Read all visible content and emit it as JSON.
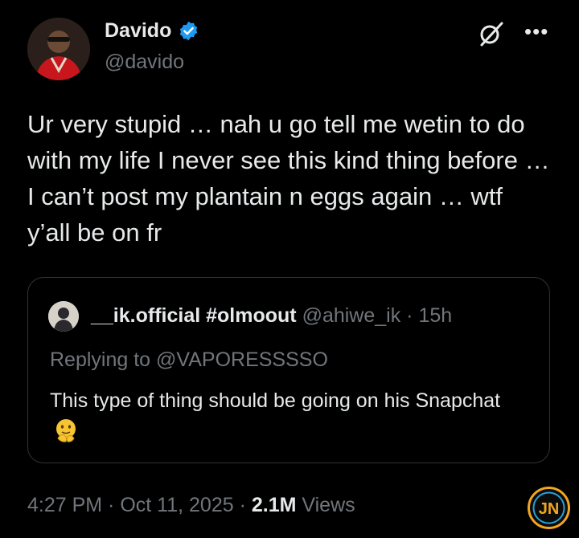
{
  "author": {
    "name": "Davido",
    "handle": "@davido",
    "verified": true
  },
  "tweet": {
    "text": "Ur very stupid … nah u go tell me wetin to do with my life I never see this kind thing before … I can’t post my plantain n eggs again … wtf y’all be on fr"
  },
  "quote": {
    "name": "__ik.official #olmoout",
    "handle": "@ahiwe_ik",
    "separator": " · ",
    "time": "15h",
    "replying_to": "Replying to @VAPORESSSSO",
    "text": "This type of thing should be going on his Snapchat"
  },
  "footer": {
    "time": "4:27 PM",
    "dot1": " · ",
    "date": "Oct 11, 2025",
    "dot2": " · ",
    "views_count": "2.1M",
    "views_label": " Views"
  },
  "more_label": "•••",
  "icons": {
    "verified": "verified-badge-icon",
    "grok": "grok-icon",
    "more": "more-options-icon",
    "emoji": "shushing-face-emoji",
    "logo": "jn-watermark-logo"
  },
  "colors": {
    "background": "#000000",
    "text": "#e7e9ea",
    "muted": "#71767b",
    "border": "#2f3336",
    "verified": "#1d9bf0"
  }
}
